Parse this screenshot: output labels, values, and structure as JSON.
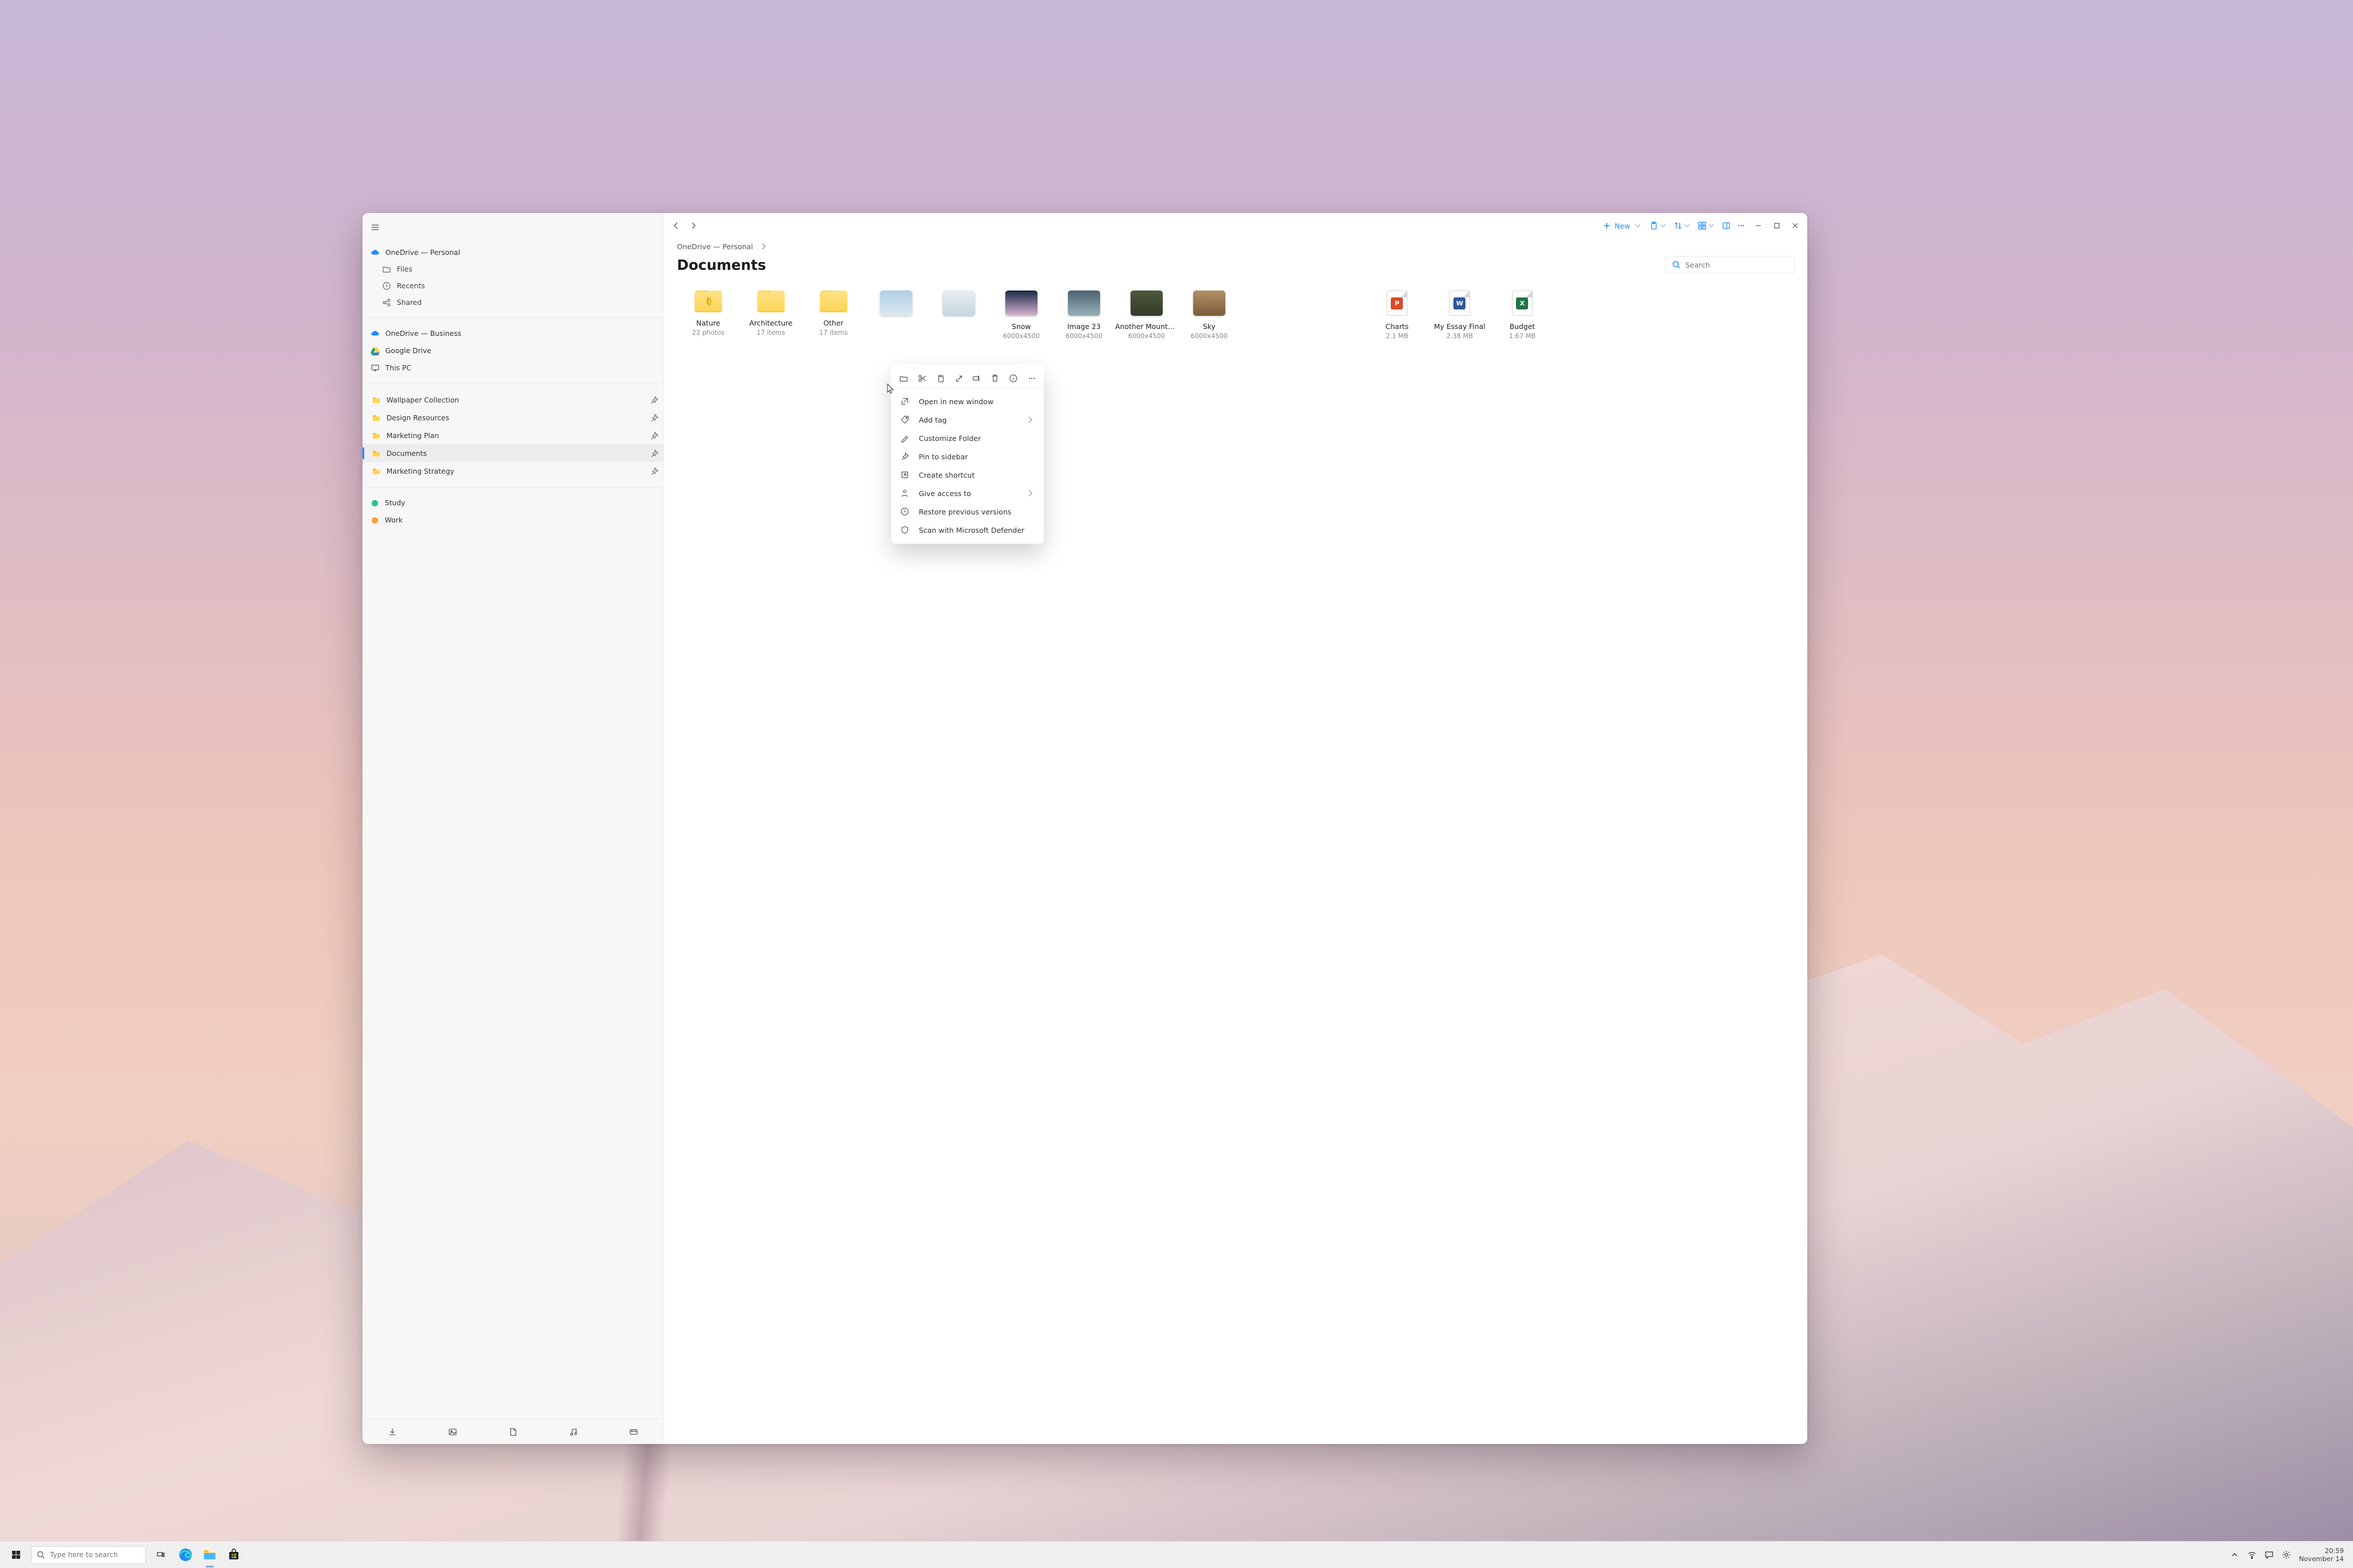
{
  "sidebar": {
    "source_primary": "OneDrive — Personal",
    "sub": {
      "files": "Files",
      "recents": "Recents",
      "shared": "Shared"
    },
    "sources": {
      "onedrive_business": "OneDrive — Business",
      "google_drive": "Google Drive",
      "this_pc": "This PC"
    },
    "pinned": [
      {
        "label": "Wallpaper Collection"
      },
      {
        "label": "Design Resources"
      },
      {
        "label": "Marketing Plan"
      },
      {
        "label": "Documents"
      },
      {
        "label": "Marketing Strategy"
      }
    ],
    "tags": [
      {
        "label": "Study",
        "color": "#25c48b"
      },
      {
        "label": "Work",
        "color": "#ff9a3c"
      }
    ]
  },
  "toolbar": {
    "new_label": "New"
  },
  "breadcrumb": {
    "root": "OneDrive — Personal"
  },
  "page_title": "Documents",
  "search": {
    "placeholder": "Search"
  },
  "tiles": [
    {
      "kind": "folder",
      "name": "Nature",
      "meta": "22 photos",
      "leaf": true
    },
    {
      "kind": "folder",
      "name": "Architecture",
      "meta": "17 items"
    },
    {
      "kind": "folder",
      "name": "Other",
      "meta": "17 items"
    },
    {
      "kind": "image",
      "name": "",
      "meta": "",
      "grad": [
        "#aecfe6",
        "#dde9f2"
      ]
    },
    {
      "kind": "image",
      "name": "",
      "meta": "",
      "grad": [
        "#e9eef2",
        "#c6d6e1"
      ]
    },
    {
      "kind": "image",
      "name": "Snow",
      "meta": "6000x4500",
      "grad": [
        "#1c2848",
        "#d8b5cf"
      ]
    },
    {
      "kind": "image",
      "name": "Image 23",
      "meta": "6000x4500",
      "grad": [
        "#4a6272",
        "#98b0b8"
      ]
    },
    {
      "kind": "image",
      "name": "Another Mountain",
      "meta": "6000x4500",
      "grad": [
        "#4e5a3a",
        "#323a2a"
      ]
    },
    {
      "kind": "image",
      "name": "Sky",
      "meta": "6000x4500",
      "grad": [
        "#b49066",
        "#7a5c3a"
      ]
    },
    {
      "kind": "gap"
    },
    {
      "kind": "gap"
    },
    {
      "kind": "file",
      "name": "Charts",
      "meta": "2.1 MB",
      "badge": "P",
      "badgeColor": "#d64b2a"
    },
    {
      "kind": "file",
      "name": "My Essay Final",
      "meta": "2.38 MB",
      "badge": "W",
      "badgeColor": "#2b579a"
    },
    {
      "kind": "file",
      "name": "Budget",
      "meta": "1.67 MB",
      "badge": "X",
      "badgeColor": "#217346"
    }
  ],
  "context_menu": {
    "items": [
      {
        "label": "Open in new window",
        "icon": "open-external",
        "chev": false
      },
      {
        "label": "Add tag",
        "icon": "tag",
        "chev": true
      },
      {
        "label": "Customize Folder",
        "icon": "pencil",
        "chev": false
      },
      {
        "label": "Pin to sidebar",
        "icon": "pin",
        "chev": false
      },
      {
        "label": "Create shortcut",
        "icon": "shortcut",
        "chev": false
      },
      {
        "label": "Give access to",
        "icon": "person",
        "chev": true
      },
      {
        "label": "Restore previous versions",
        "icon": "history",
        "chev": false
      },
      {
        "label": "Scan with Microsoft Defender",
        "icon": "shield",
        "chev": false
      }
    ]
  },
  "taskbar": {
    "search_placeholder": "Type here to search",
    "time": "20:59",
    "date": "November 14"
  }
}
